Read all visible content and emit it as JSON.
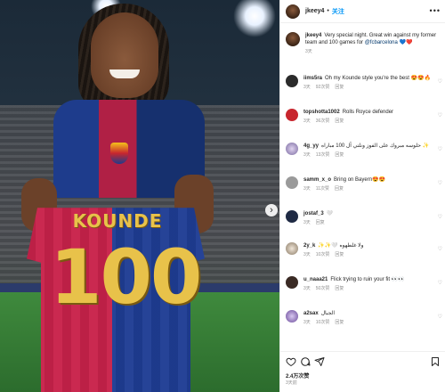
{
  "post": {
    "shirt_name": "KOUNDE",
    "shirt_number": "100"
  },
  "header": {
    "username": "jkeey4",
    "separator": "•",
    "follow_label": "关注",
    "more_label": "•••"
  },
  "caption": {
    "username": "jkeey4",
    "text": "Very special night. Great win against my former team and 100 games for ",
    "tag": "@fcbarcelona",
    "emojis": "💙❤️",
    "time": "3天"
  },
  "comments": [
    {
      "username": "iims5ra",
      "text": "Oh my Kounde style you're the best 😍😍🔥",
      "time": "3天",
      "likes": "92次赞",
      "reply": "回复"
    },
    {
      "username": "topshotta1002",
      "text": "Rolls Royce defender",
      "time": "3天",
      "likes": "36次赞",
      "reply": "回复"
    },
    {
      "username": "4g_yy",
      "text": "حلوسه مبروك على الفوز ونلتي آل 100 مباراه ✨",
      "time": "3天",
      "likes": "13次赞",
      "reply": "回复"
    },
    {
      "username": "samm_x_o",
      "text": "Bring on Bayern😍😍",
      "time": "3天",
      "likes": "11次赞",
      "reply": "回复"
    },
    {
      "username": "jostaf_3",
      "text": "🤍",
      "time": "3天",
      "likes": "",
      "reply": "回复"
    },
    {
      "username": "2y_k",
      "text": "✨✨🤍 ولا غلطهوه",
      "time": "3天",
      "likes": "10次赞",
      "reply": "回复"
    },
    {
      "username": "u_naaa21",
      "text": "Flick trying to ruin your fit 👀👀",
      "time": "3天",
      "likes": "50次赞",
      "reply": "回复"
    },
    {
      "username": "a2sax",
      "text": "الجبال",
      "time": "3天",
      "likes": "10次赞",
      "reply": "回复"
    }
  ],
  "footer": {
    "likes": "2.4万次赞",
    "date": "3天前"
  },
  "icons": {
    "heart": "heart-icon",
    "comment": "comment-icon",
    "share": "share-icon",
    "bookmark": "bookmark-icon",
    "next": "chevron-right-icon"
  },
  "colors": {
    "link": "#0095f6",
    "tag": "#00376b",
    "muted": "#8e8e8e",
    "text": "#262626"
  }
}
